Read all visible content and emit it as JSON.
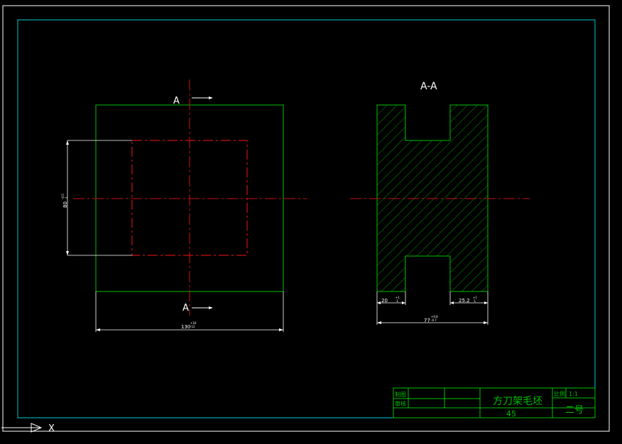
{
  "drawing": {
    "section_label": "A-A",
    "cut_marker_top": "A",
    "cut_marker_bottom": "A",
    "dim_height": "80",
    "dim_height_tol_upper": "-0.5",
    "dim_height_tol_lower": "-1",
    "dim_width": "130",
    "dim_width_tol_upper": "+10",
    "dim_width_tol_lower": "-12",
    "dim_left_flange": "20",
    "dim_left_flange_tol_upper": "+1",
    "dim_left_flange_tol_lower": "-1",
    "dim_right_flange": "25.2",
    "dim_right_flange_tol_upper": "+1",
    "dim_right_flange_tol_lower": "-1",
    "dim_thickness": "77",
    "dim_thickness_tol_upper": "+0.8",
    "dim_thickness_tol_lower": "-0.7"
  },
  "title_block": {
    "drawn_by_label": "制图",
    "checked_by_label": "审核",
    "part_name": "方刀架毛坯",
    "material": "45",
    "scale_label": "比例",
    "scale_value": "1:1",
    "sheet_label": "二号"
  },
  "ucs": {
    "axis_label": "X"
  },
  "colors": {
    "background": "#000000",
    "border": "#00cccc",
    "outline": "#00c000",
    "centerline": "#cc1111",
    "dimension": "#ffffff"
  }
}
